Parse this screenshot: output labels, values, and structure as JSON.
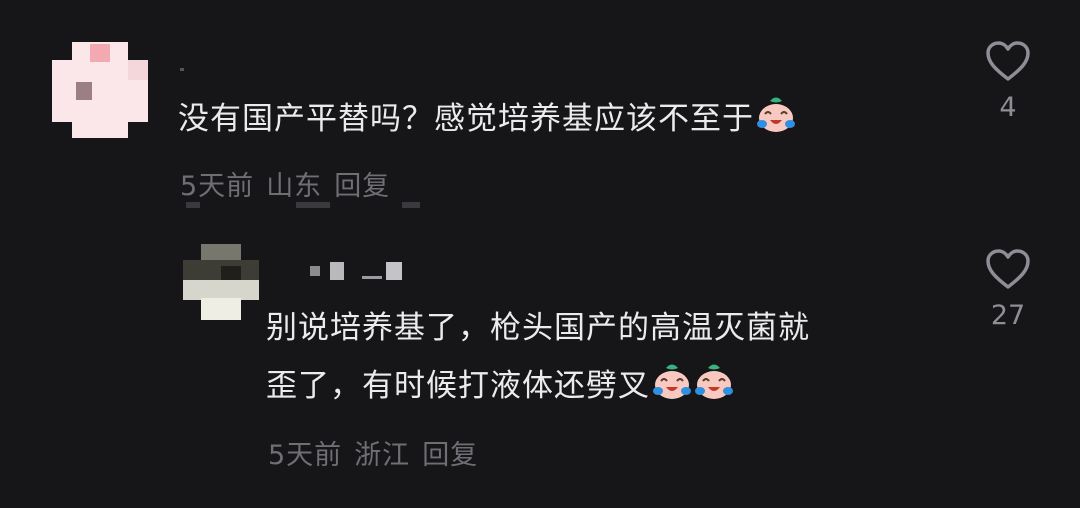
{
  "comments": [
    {
      "text": "没有国产平替吗？感觉培养基应该不至于",
      "time": "5天前",
      "location": "山东",
      "reply_label": "回复",
      "like_count": "4",
      "emoji_count": 1
    },
    {
      "text_line1": "别说培养基了，枪头国产的高温灭菌就",
      "text_line2": "歪了，有时候打液体还劈叉",
      "time": "5天前",
      "location": "浙江",
      "reply_label": "回复",
      "like_count": "27",
      "emoji_count": 2
    }
  ],
  "icons": {
    "like": "heart-outline-icon",
    "emoji": "crying-laughing-emoji-icon"
  },
  "colors": {
    "background": "#161518",
    "text": "#ebebed",
    "meta": "#6f6e75",
    "like_count": "#8f8e95"
  }
}
